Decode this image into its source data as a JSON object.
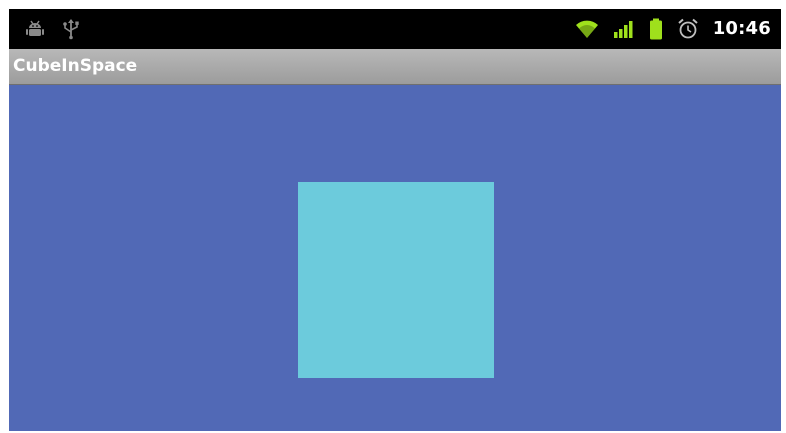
{
  "status_bar": {
    "left_icons": [
      "android-icon",
      "usb-icon"
    ],
    "right_icons": [
      "wifi-icon",
      "signal-icon",
      "battery-icon",
      "alarm-icon"
    ],
    "time": "10:46"
  },
  "app": {
    "title": "CubeInSpace"
  },
  "colors": {
    "background": "#5169b6",
    "cube": "#6ccbdc",
    "status_icons_green": "#9fe01c",
    "title_bar": "#a8a8a8"
  }
}
